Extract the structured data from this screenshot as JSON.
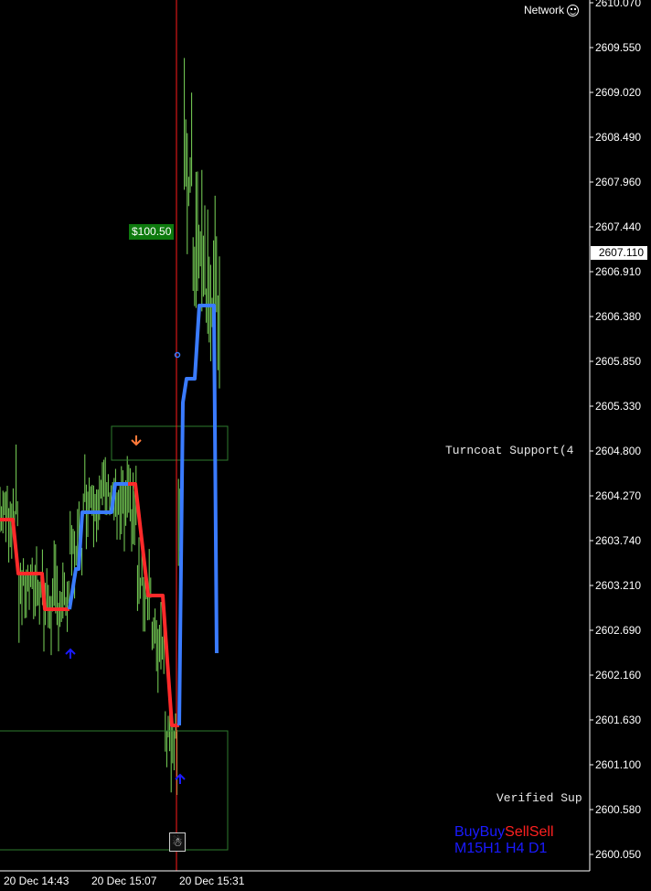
{
  "header": {
    "network_label": "Network",
    "network_icon": "smiley-icon"
  },
  "price_axis": {
    "labels": [
      "2610.070",
      "2609.550",
      "2609.020",
      "2608.490",
      "2607.960",
      "2607.440",
      "2606.910",
      "2606.380",
      "2605.850",
      "2605.330",
      "2604.800",
      "2604.270",
      "2603.740",
      "2603.210",
      "2602.690",
      "2602.160",
      "2601.630",
      "2601.100",
      "2600.580",
      "2600.050"
    ],
    "current_price": "2607.110"
  },
  "time_axis": {
    "labels": [
      "20 Dec 14:43",
      "20 Dec 15:07",
      "20 Dec 15:31"
    ]
  },
  "annotations": {
    "profit_badge": "$100.50",
    "resistance_zone_label": "Turncoat Support(4",
    "support_zone_label": "Verified Sup"
  },
  "signals": {
    "row1": [
      "Buy",
      "Buy",
      "Sell",
      "Sell"
    ],
    "row2": [
      "M15",
      "H1",
      "H4",
      "D1"
    ]
  },
  "colors": {
    "background": "#000000",
    "candles": "#7bd65a",
    "up_trend": "#3a7bff",
    "down_trend": "#ff2a2a",
    "vertical_marker": "#ff1a1a",
    "zone_border": "#2e7d2e",
    "buy": "#1a1aff",
    "sell": "#ff2020"
  },
  "chart_data": {
    "type": "line",
    "price_range": [
      2600.05,
      2610.07
    ],
    "trend_line": {
      "down_segments_prices": [
        2604.0,
        2603.35,
        2602.93,
        2603.15,
        2604.6,
        2603.0,
        2601.5
      ],
      "up_segments_prices": [
        2601.5,
        2605.5,
        2606.4,
        2602.6
      ]
    },
    "arrows": [
      {
        "direction": "down",
        "price": 2604.9
      },
      {
        "direction": "up",
        "price": 2602.3
      },
      {
        "direction": "up",
        "price": 2601.0
      }
    ],
    "zones": [
      {
        "name": "resistance",
        "top": 2605.05,
        "bottom": 2604.7
      },
      {
        "name": "support",
        "top": 2601.45,
        "bottom": 2600.1
      }
    ]
  }
}
